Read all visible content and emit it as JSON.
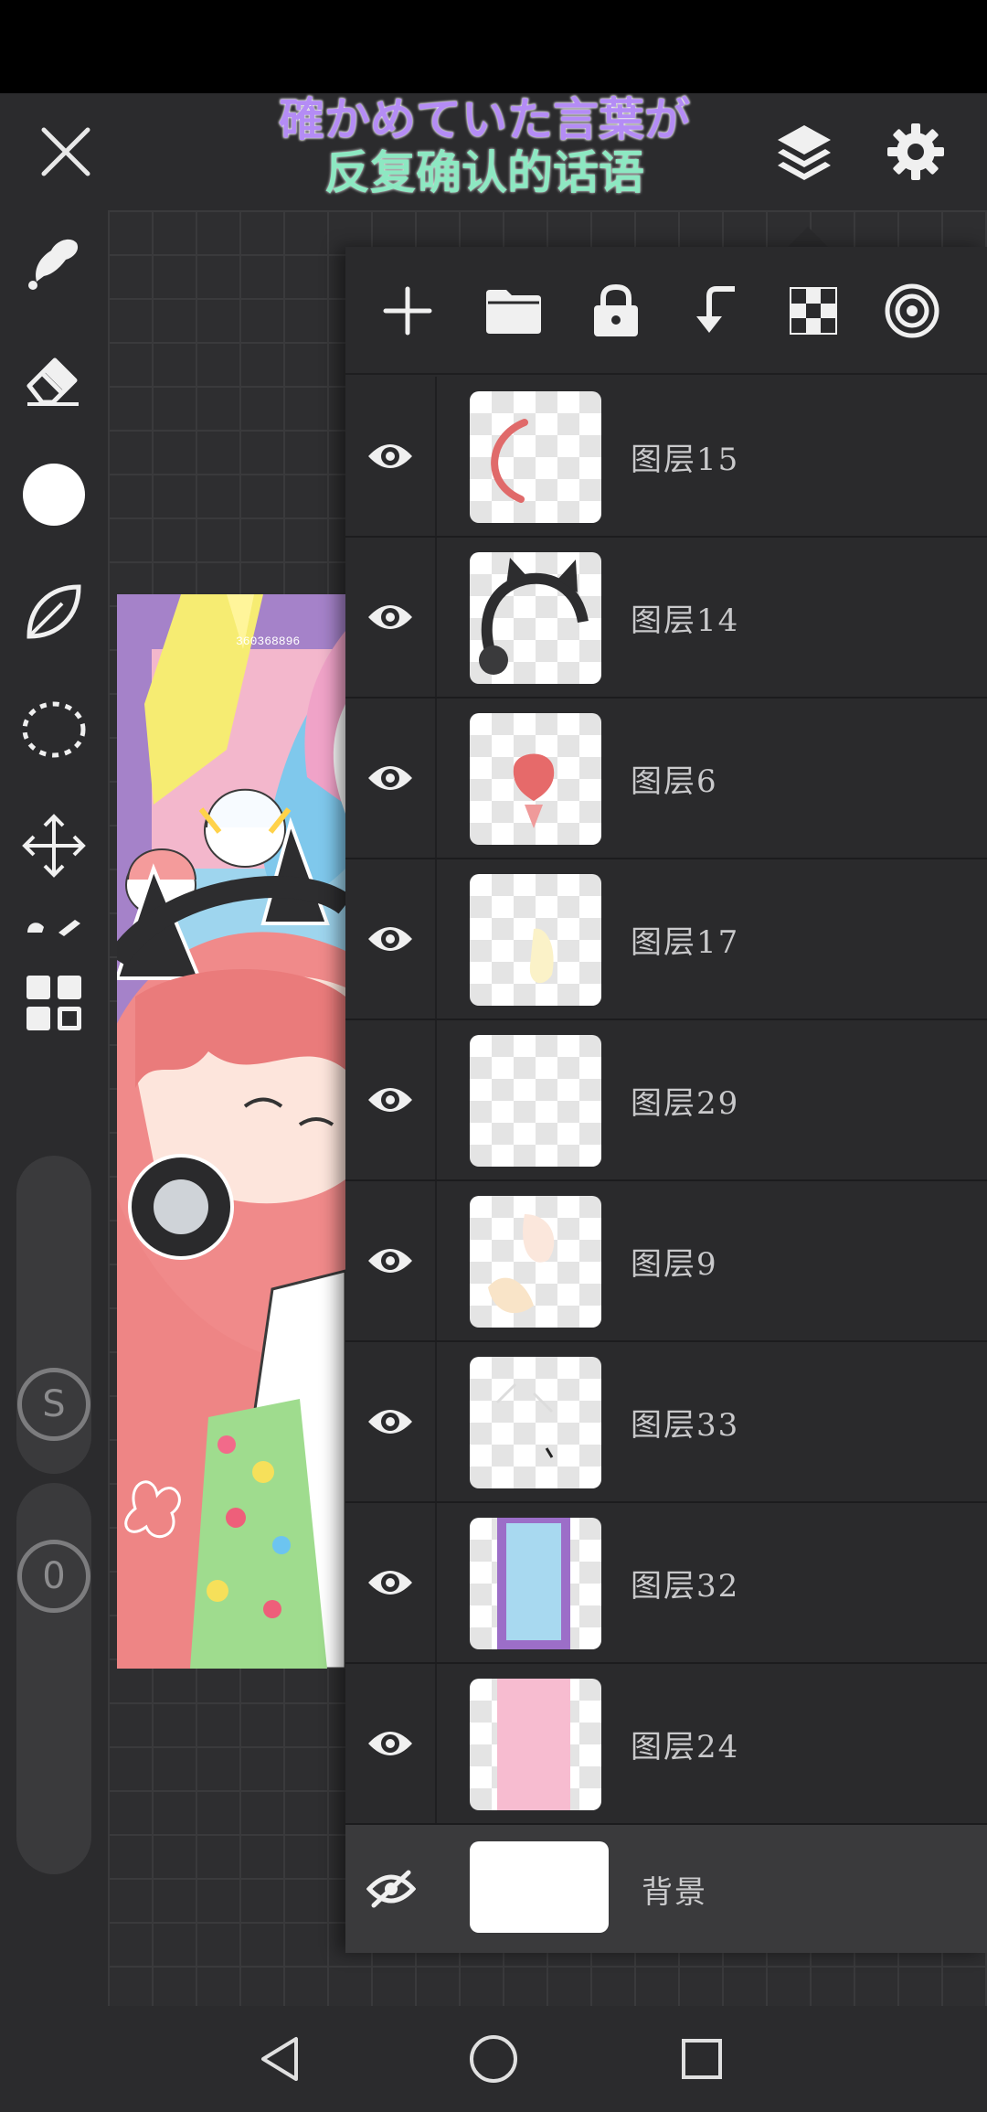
{
  "caption": {
    "line1": "確かめていた言葉が",
    "line2": "反复确认的话语"
  },
  "icons": {
    "close": "close-icon",
    "layers": "layers-icon",
    "settings": "gear-icon",
    "tools": [
      "smudge-icon",
      "eraser-icon",
      "brush-color-icon",
      "leaf-brush-icon",
      "lasso-select-icon",
      "move-transform-icon",
      "fill-icon",
      "grid-menu-icon"
    ],
    "panel_toolbar": [
      "add-layer-icon",
      "folder-icon",
      "lock-icon",
      "merge-down-icon",
      "transparency-checker-icon",
      "target-icon"
    ]
  },
  "sliders": {
    "size_label": "S",
    "opacity_label": "0"
  },
  "artwork": {
    "number_text": "360368896"
  },
  "layers": [
    {
      "name": "图层15",
      "visible": true,
      "thumb": "red-arc"
    },
    {
      "name": "图层14",
      "visible": true,
      "thumb": "cat-headphones"
    },
    {
      "name": "图层6",
      "visible": true,
      "thumb": "red-figure"
    },
    {
      "name": "图层17",
      "visible": true,
      "thumb": "yellow-light"
    },
    {
      "name": "图层29",
      "visible": true,
      "thumb": "empty"
    },
    {
      "name": "图层9",
      "visible": true,
      "thumb": "skin-sketch"
    },
    {
      "name": "图层33",
      "visible": true,
      "thumb": "white-lines"
    },
    {
      "name": "图层32",
      "visible": true,
      "thumb": "blue-frame"
    },
    {
      "name": "图层24",
      "visible": true,
      "thumb": "pink-band"
    },
    {
      "name": "背景",
      "visible": false,
      "thumb": "white"
    }
  ],
  "colors": {
    "accent_purple": "#b48cf5",
    "accent_mint": "#8de8c2",
    "panel_bg": "#2a2a2c",
    "app_bg": "#2b2b2d"
  }
}
